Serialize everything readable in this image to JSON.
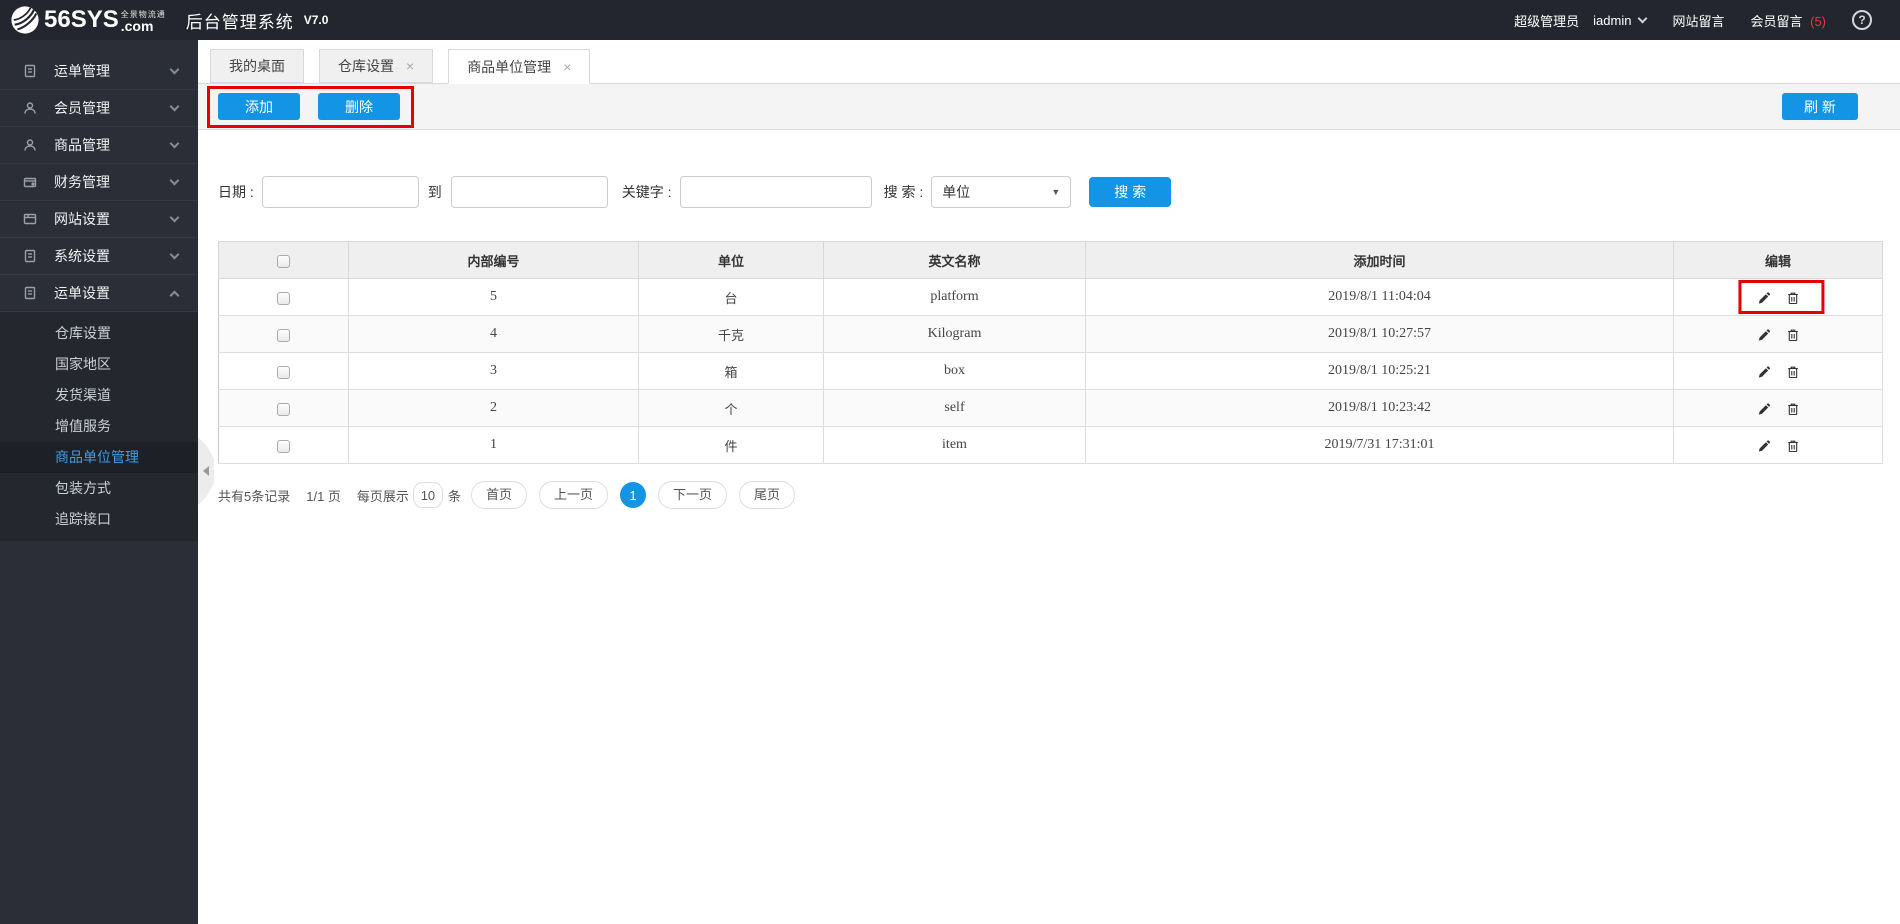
{
  "topbar": {
    "logo_main": "56SYS",
    "logo_sub": "全景物流通",
    "logo_com": ".com",
    "title": "后台管理系统",
    "version": "V7.0",
    "user_role": "超级管理员",
    "username": "iadmin",
    "site_messages_label": "网站留言",
    "member_messages_label": "会员留言",
    "member_message_count": "(5)",
    "help_glyph": "?"
  },
  "sidebar": {
    "items": [
      {
        "label": "运单管理",
        "icon": "waybill-doc-icon",
        "expanded": false
      },
      {
        "label": "会员管理",
        "icon": "member-person-icon",
        "expanded": false
      },
      {
        "label": "商品管理",
        "icon": "product-person-icon",
        "expanded": false
      },
      {
        "label": "财务管理",
        "icon": "finance-wallet-icon",
        "expanded": false
      },
      {
        "label": "网站设置",
        "icon": "website-browser-icon",
        "expanded": false
      },
      {
        "label": "系统设置",
        "icon": "system-doc-icon",
        "expanded": false
      },
      {
        "label": "运单设置",
        "icon": "waybill-settings-doc-icon",
        "expanded": true
      }
    ],
    "submenu": [
      {
        "label": "仓库设置",
        "active": false
      },
      {
        "label": "国家地区",
        "active": false
      },
      {
        "label": "发货渠道",
        "active": false
      },
      {
        "label": "增值服务",
        "active": false
      },
      {
        "label": "商品单位管理",
        "active": true
      },
      {
        "label": "包装方式",
        "active": false
      },
      {
        "label": "追踪接口",
        "active": false
      }
    ]
  },
  "tabs": [
    {
      "label": "我的桌面",
      "closable": false
    },
    {
      "label": "仓库设置",
      "closable": true
    },
    {
      "label": "商品单位管理",
      "closable": true,
      "active": true
    }
  ],
  "glyphs": {
    "close": "×",
    "select_arrow": "▼"
  },
  "toolbar": {
    "add_label": "添加",
    "delete_label": "删除",
    "refresh_label": "刷 新"
  },
  "filters": {
    "date_label": "日期 :",
    "to_label": "到",
    "keyword_label": "关键字 :",
    "search_by_label": "搜 索 :",
    "search_select_value": "单位",
    "search_button_label": "搜 索"
  },
  "table": {
    "headers": [
      "内部编号",
      "单位",
      "英文名称",
      "添加时间",
      "编辑"
    ],
    "rows": [
      {
        "id": "5",
        "unit": "台",
        "english": "platform",
        "added": "2019/8/1 11:04:04"
      },
      {
        "id": "4",
        "unit": "千克",
        "english": "Kilogram",
        "added": "2019/8/1 10:27:57"
      },
      {
        "id": "3",
        "unit": "箱",
        "english": "box",
        "added": "2019/8/1 10:25:21"
      },
      {
        "id": "2",
        "unit": "个",
        "english": "self",
        "added": "2019/8/1 10:23:42"
      },
      {
        "id": "1",
        "unit": "件",
        "english": "item",
        "added": "2019/7/31 17:31:01"
      }
    ]
  },
  "pagination": {
    "total_text": "共有5条记录",
    "page_text": "1/1 页",
    "per_page_label": "每页展示",
    "per_page_value": "10",
    "unit_label": "条",
    "first_label": "首页",
    "prev_label": "上一页",
    "current_page": "1",
    "next_label": "下一页",
    "last_label": "尾页"
  },
  "colors": {
    "accent_blue": "#1494e4",
    "annotation_red": "#e60000",
    "topbar_bg": "#23262e",
    "sidebar_bg": "#2b2e37",
    "active_link": "#3e9de4",
    "message_count_red": "#e4393c"
  }
}
